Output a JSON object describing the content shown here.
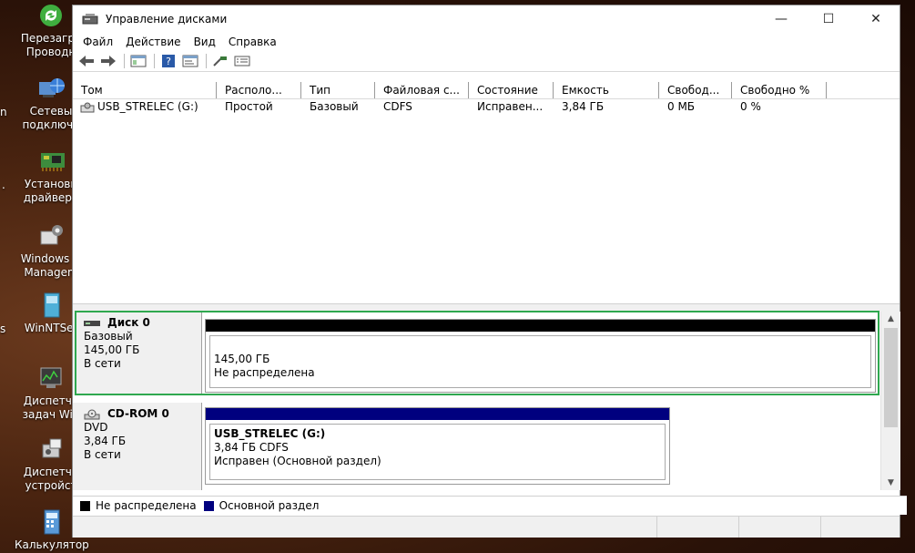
{
  "desktop": {
    "icons": [
      {
        "label_line1": "Перезагру",
        "label_line2": "Проводн"
      },
      {
        "label_line1": "Сетевы",
        "label_line2": "подключе"
      },
      {
        "label_line1": "Установи",
        "label_line2": "драйвера"
      },
      {
        "label_line1": "Windows D",
        "label_line2": "Managem"
      },
      {
        "label_line1": "WinNTSet",
        "label_line2": ""
      },
      {
        "label_line1": "Диспетче",
        "label_line2": "задач Win"
      },
      {
        "label_line1": "Диспетче",
        "label_line2": "устройст"
      },
      {
        "label_line1": "Калькулятор",
        "label_line2": ""
      }
    ],
    "edge_chars": {
      "a": "n",
      "b": ".",
      "c": "s"
    }
  },
  "window": {
    "title": "Управление дисками",
    "controls": {
      "minimize": "—",
      "maximize": "☐",
      "close": "✕"
    }
  },
  "menu": [
    "Файл",
    "Действие",
    "Вид",
    "Справка"
  ],
  "volumes": {
    "columns": [
      "Том",
      "Располо...",
      "Тип",
      "Файловая с...",
      "Состояние",
      "Емкость",
      "Свобод...",
      "Свободно %"
    ],
    "rows": [
      {
        "name": "USB_STRELEC (G:)",
        "layout": "Простой",
        "type": "Базовый",
        "fs": "CDFS",
        "status": "Исправен...",
        "capacity": "3,84 ГБ",
        "free": "0 МБ",
        "free_pct": "0 %"
      }
    ]
  },
  "disks": [
    {
      "name": "Диск 0",
      "kind": "Базовый",
      "size": "145,00 ГБ",
      "state": "В сети",
      "partition": {
        "line1": "145,00 ГБ",
        "line2": "Не распределена",
        "bar_color": "#000000"
      }
    },
    {
      "name": "CD-ROM 0",
      "kind": "DVD",
      "size": "3,84 ГБ",
      "state": "В сети",
      "partition": {
        "title": "USB_STRELEC  (G:)",
        "line1": "3,84 ГБ CDFS",
        "line2": "Исправен (Основной раздел)",
        "bar_color": "#00007f"
      }
    }
  ],
  "legend": [
    {
      "label": "Не распределена",
      "color": "#000000"
    },
    {
      "label": "Основной раздел",
      "color": "#00007f"
    }
  ],
  "colors": {
    "selection_border": "#2fa84f"
  }
}
